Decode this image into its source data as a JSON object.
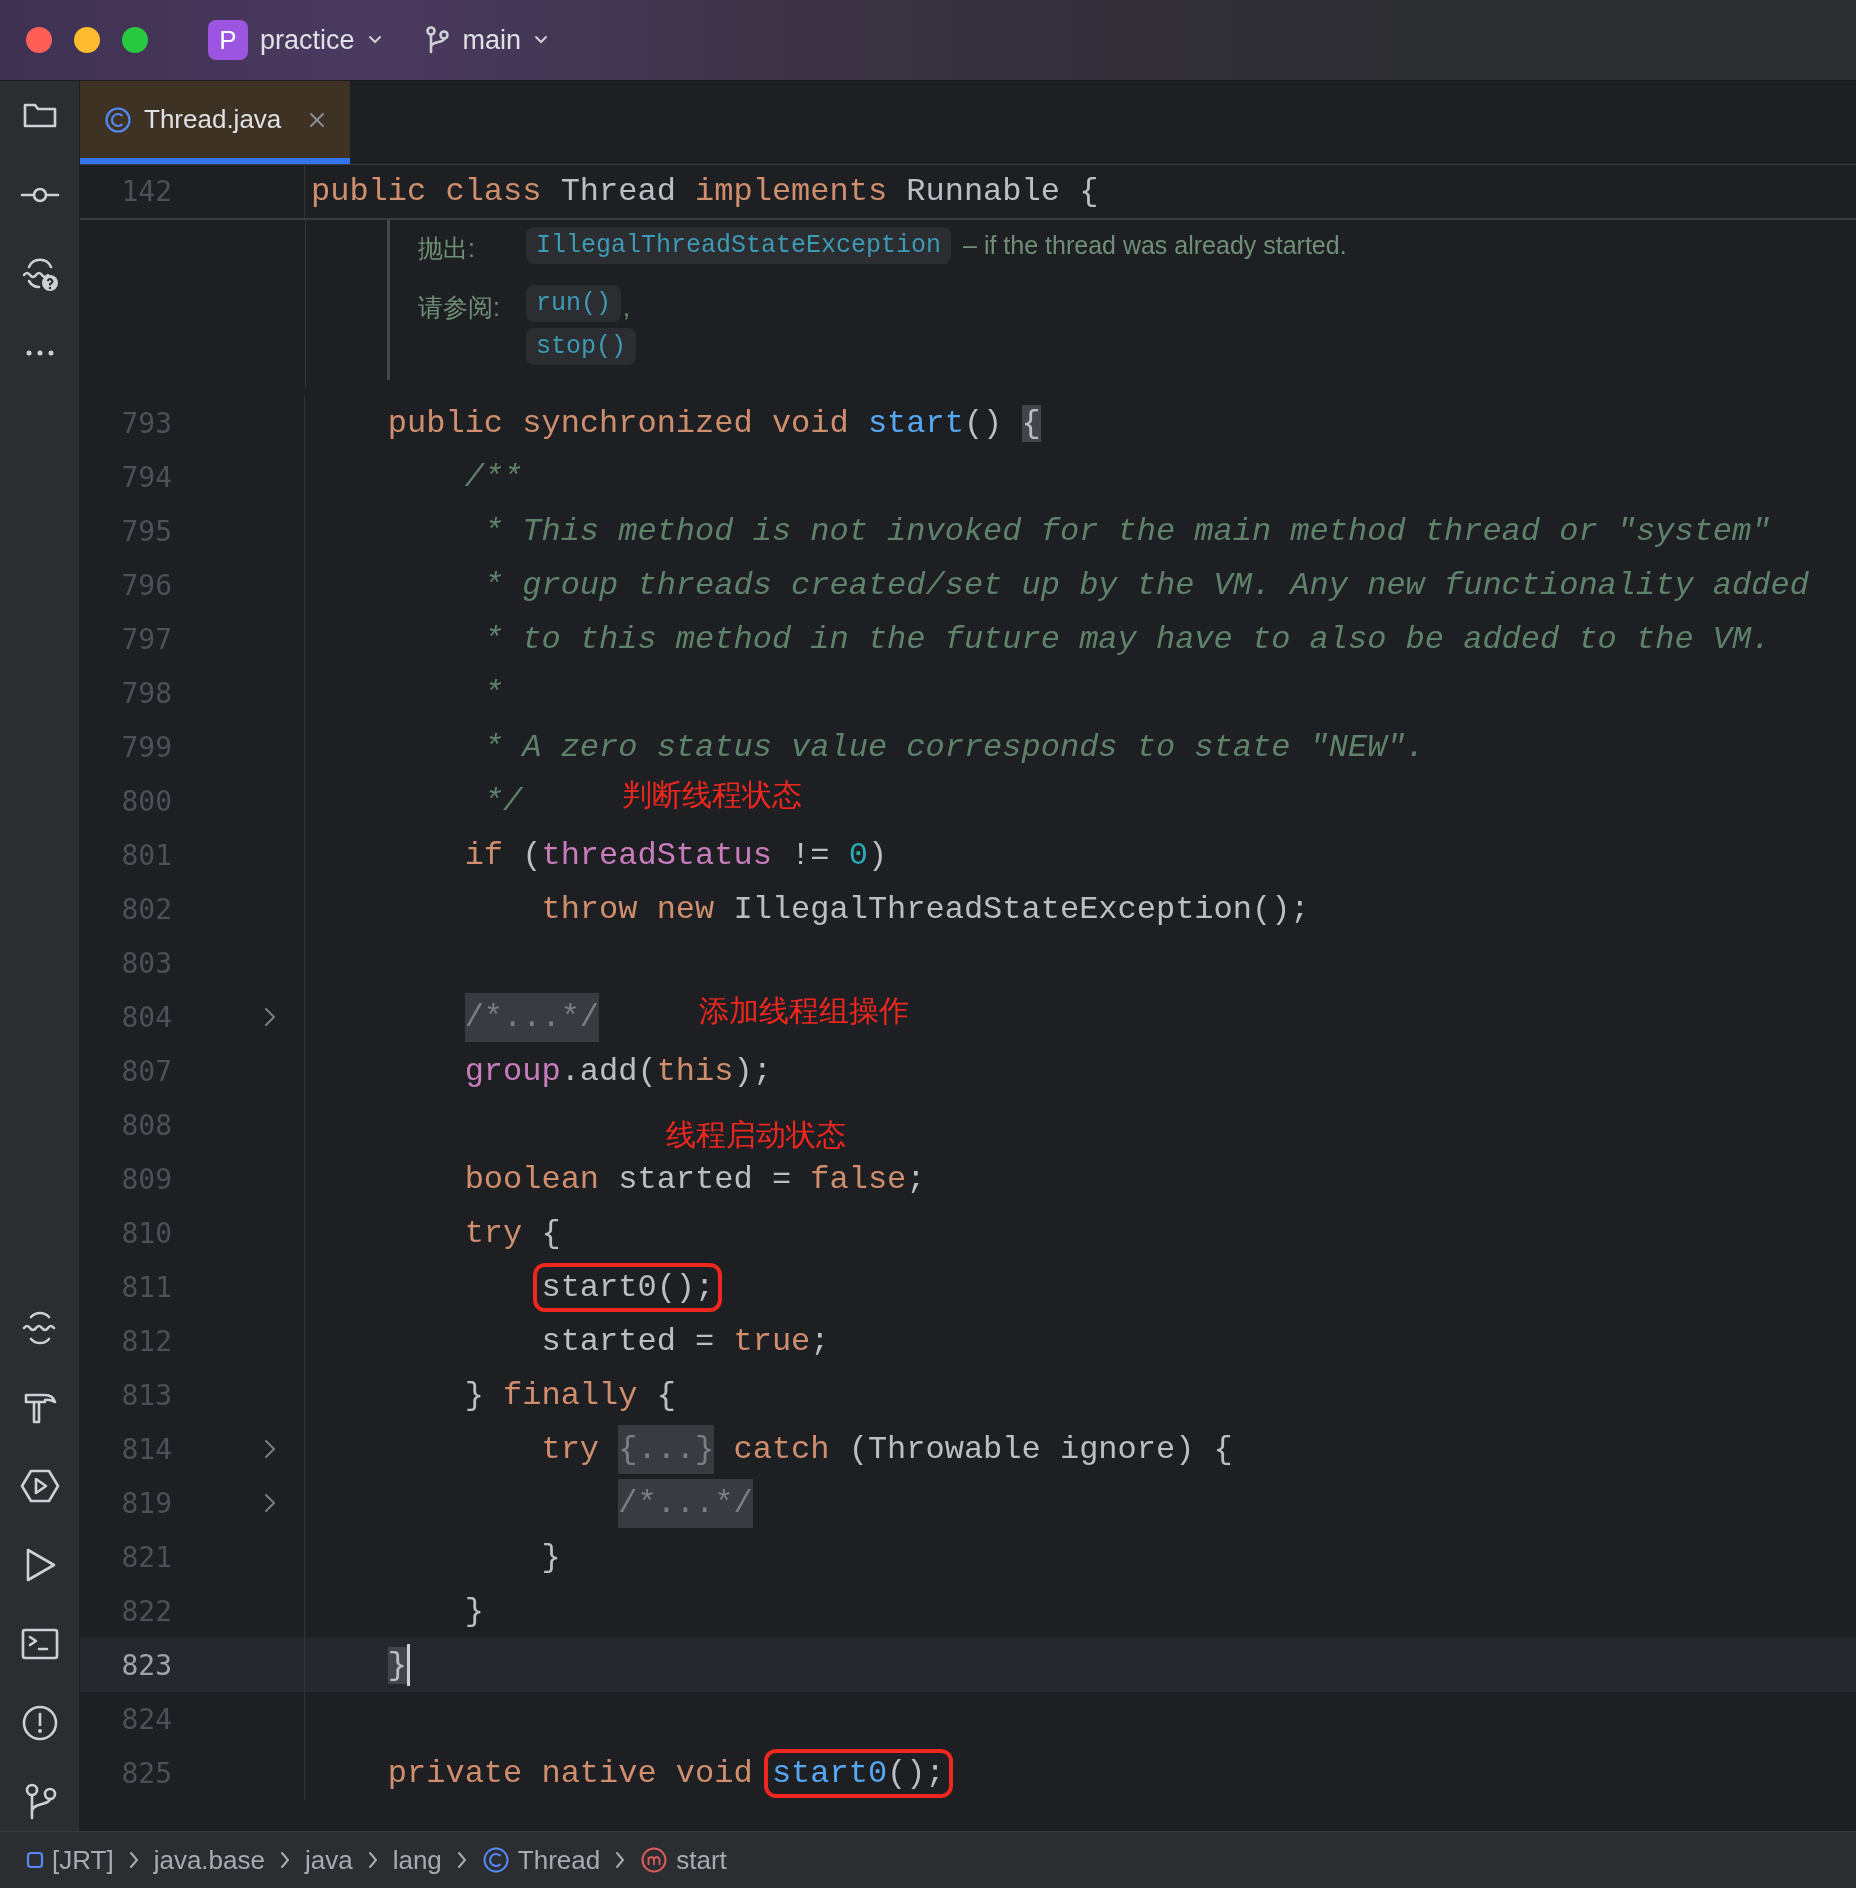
{
  "title_bar": {
    "project": {
      "badge": "P",
      "name": "practice"
    },
    "branch": {
      "name": "main"
    }
  },
  "tabs": [
    {
      "label": "Thread.java",
      "selected": true
    }
  ],
  "sticky_line": {
    "number": "142",
    "tokens": [
      {
        "text": "public class ",
        "kind": "keyword"
      },
      {
        "text": "Thread ",
        "kind": "plain"
      },
      {
        "text": "implements ",
        "kind": "keyword"
      },
      {
        "text": "Runnable {",
        "kind": "plain"
      }
    ]
  },
  "doc": {
    "throws": {
      "label": "抛出:",
      "exception": "IllegalThreadStateException",
      "text": "– if the thread was already started."
    },
    "see": {
      "label": "请参阅:",
      "refs": [
        "run()",
        "stop()"
      ],
      "separator": ","
    }
  },
  "lines": [
    {
      "number": "793",
      "foldable": false,
      "current": false,
      "tokens": [
        {
          "text": "    public synchronized void ",
          "kind": "keyword"
        },
        {
          "text": "start",
          "kind": "method"
        },
        {
          "text": "() ",
          "kind": "plain"
        },
        {
          "text": "{",
          "kind": "brace"
        }
      ]
    },
    {
      "number": "794",
      "foldable": false,
      "current": false,
      "tokens": [
        {
          "text": "        /**",
          "kind": "doc"
        }
      ]
    },
    {
      "number": "795",
      "foldable": false,
      "current": false,
      "tokens": [
        {
          "text": "         * This method is not invoked for the main method thread or \"system\"",
          "kind": "doc"
        }
      ]
    },
    {
      "number": "796",
      "foldable": false,
      "current": false,
      "tokens": [
        {
          "text": "         * group threads created/set up by the VM. Any new functionality added",
          "kind": "doc"
        }
      ]
    },
    {
      "number": "797",
      "foldable": false,
      "current": false,
      "tokens": [
        {
          "text": "         * to this method in the future may have to also be added to the VM.",
          "kind": "doc"
        }
      ]
    },
    {
      "number": "798",
      "foldable": false,
      "current": false,
      "tokens": [
        {
          "text": "         *",
          "kind": "doc"
        }
      ]
    },
    {
      "number": "799",
      "foldable": false,
      "current": false,
      "tokens": [
        {
          "text": "         * A zero status value corresponds to state \"NEW\".",
          "kind": "doc"
        }
      ]
    },
    {
      "number": "800",
      "foldable": false,
      "current": false,
      "tokens": [
        {
          "text": "         */",
          "kind": "doc"
        },
        {
          "text": "判断线程状态",
          "kind": "note"
        }
      ]
    },
    {
      "number": "801",
      "foldable": false,
      "current": false,
      "tokens": [
        {
          "text": "        if",
          "kind": "keyword"
        },
        {
          "text": " (",
          "kind": "plain"
        },
        {
          "text": "threadStatus",
          "kind": "field"
        },
        {
          "text": " != ",
          "kind": "plain"
        },
        {
          "text": "0",
          "kind": "number"
        },
        {
          "text": ")",
          "kind": "plain"
        }
      ]
    },
    {
      "number": "802",
      "foldable": false,
      "current": false,
      "tokens": [
        {
          "text": "            throw new ",
          "kind": "keyword"
        },
        {
          "text": "IllegalThreadStateException();",
          "kind": "plain"
        }
      ]
    },
    {
      "number": "803",
      "foldable": false,
      "current": false
    },
    {
      "number": "804",
      "foldable": true,
      "current": false,
      "tokens": [
        {
          "text": "        /*...*/",
          "kind": "folded"
        },
        {
          "text": "添加线程组操作",
          "kind": "note"
        }
      ]
    },
    {
      "number": "807",
      "foldable": false,
      "current": false,
      "tokens": [
        {
          "text": "        group",
          "kind": "field"
        },
        {
          "text": ".add(",
          "kind": "plain"
        },
        {
          "text": "this",
          "kind": "keyword"
        },
        {
          "text": ");",
          "kind": "plain"
        }
      ]
    },
    {
      "number": "808",
      "foldable": false,
      "current": false,
      "tokens": [
        {
          "text": "线程启动状态",
          "kind": "note"
        }
      ]
    },
    {
      "number": "809",
      "foldable": false,
      "current": false,
      "tokens": [
        {
          "text": "        boolean",
          "kind": "keyword"
        },
        {
          "text": " started = ",
          "kind": "plain"
        },
        {
          "text": "false",
          "kind": "keyword"
        },
        {
          "text": ";",
          "kind": "plain"
        }
      ]
    },
    {
      "number": "810",
      "foldable": false,
      "current": false,
      "tokens": [
        {
          "text": "        try",
          "kind": "keyword"
        },
        {
          "text": " {",
          "kind": "plain"
        }
      ]
    },
    {
      "number": "811",
      "foldable": false,
      "current": false,
      "tokens": [
        {
          "text": "            start0();",
          "kind": "boxed"
        }
      ]
    },
    {
      "number": "812",
      "foldable": false,
      "current": false,
      "tokens": [
        {
          "text": "            started = ",
          "kind": "plain"
        },
        {
          "text": "true",
          "kind": "keyword"
        },
        {
          "text": ";",
          "kind": "plain"
        }
      ]
    },
    {
      "number": "813",
      "foldable": false,
      "current": false,
      "tokens": [
        {
          "text": "        } ",
          "kind": "plain"
        },
        {
          "text": "finally",
          "kind": "keyword"
        },
        {
          "text": " {",
          "kind": "plain"
        }
      ]
    },
    {
      "number": "814",
      "foldable": true,
      "current": false,
      "tokens": [
        {
          "text": "            try ",
          "kind": "keyword"
        },
        {
          "text": "{...}",
          "kind": "folded"
        },
        {
          "text": " catch ",
          "kind": "keyword"
        },
        {
          "text": "(Throwable ignore) {",
          "kind": "plain"
        }
      ]
    },
    {
      "number": "819",
      "foldable": true,
      "current": false,
      "tokens": [
        {
          "text": "                /*...*/",
          "kind": "folded"
        }
      ]
    },
    {
      "number": "821",
      "foldable": false,
      "current": false,
      "tokens": [
        {
          "text": "            }",
          "kind": "plain"
        }
      ]
    },
    {
      "number": "822",
      "foldable": false,
      "current": false,
      "tokens": [
        {
          "text": "        }",
          "kind": "plain"
        }
      ]
    },
    {
      "number": "823",
      "foldable": false,
      "current": true,
      "tokens": [
        {
          "text": "    }",
          "kind": "brace"
        }
      ]
    },
    {
      "number": "824",
      "foldable": false,
      "current": false
    },
    {
      "number": "825",
      "foldable": false,
      "current": false,
      "tokens": [
        {
          "text": "    private native void ",
          "kind": "keyword"
        },
        {
          "text": "start0",
          "kind": "boxed-method"
        },
        {
          "text": "();",
          "kind": "boxed"
        }
      ]
    }
  ],
  "breadcrumbs": [
    {
      "label": "[JRT]",
      "kind": "module"
    },
    {
      "label": "java.base",
      "kind": "package"
    },
    {
      "label": "java",
      "kind": "package"
    },
    {
      "label": "lang",
      "kind": "package"
    },
    {
      "label": "Thread",
      "kind": "class"
    },
    {
      "label": "start",
      "kind": "method"
    }
  ]
}
